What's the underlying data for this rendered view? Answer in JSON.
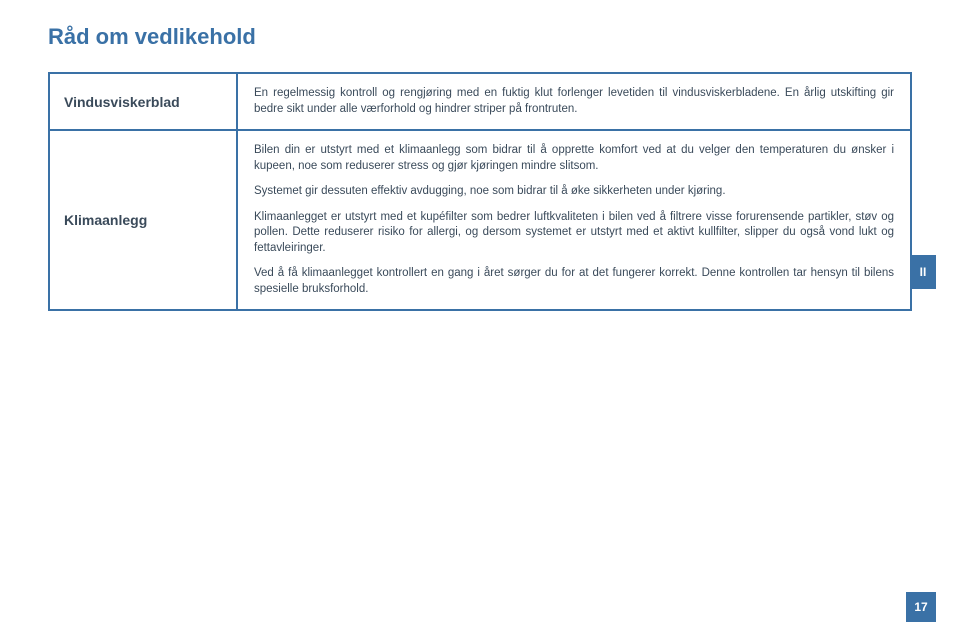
{
  "title": "Råd om vedlikehold",
  "side_tab": "II",
  "page_number": "17",
  "rows": [
    {
      "label": "Vindusviskerblad",
      "paragraphs": [
        "En regelmessig kontroll og rengjøring med en fuktig klut forlenger levetiden til vindusviskerbladene. En årlig utskifting gir bedre sikt under alle værforhold og hindrer striper på frontruten."
      ]
    },
    {
      "label": "Klimaanlegg",
      "paragraphs": [
        "Bilen din er utstyrt med et klimaanlegg som bidrar til å opprette komfort ved at du velger den temperaturen du ønsker i kupeen, noe som reduserer stress og gjør kjøringen mindre slitsom.",
        "Systemet gir dessuten effektiv avdugging, noe som bidrar til å øke sikkerheten under kjøring.",
        "Klimaanlegget er utstyrt med et kupéfilter som bedrer luftkvaliteten i bilen ved å filtrere visse forurensende partikler, støv og pollen. Dette reduserer risiko for allergi, og dersom systemet er utstyrt med et aktivt kullfilter, slipper du også vond lukt og fettavleiringer.",
        "Ved å få klimaanlegget kontrollert en gang i året sørger du for at det fungerer korrekt. Denne kontrollen tar hensyn til bilens spesielle bruksforhold."
      ]
    }
  ]
}
